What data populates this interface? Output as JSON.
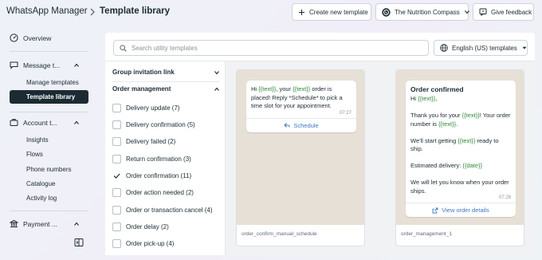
{
  "header": {
    "app_name": "WhatsApp Manager",
    "page_title": "Template library",
    "new_template_label": "Create new template",
    "account_label": "The Nutrition Compass",
    "feedback_label": "Give feedback"
  },
  "sidebar": {
    "overview": "Overview",
    "message_templates": "Message t...",
    "manage_templates": "Manage templates",
    "template_library": "Template library",
    "account_tools": "Account t...",
    "account_items": [
      "Insights",
      "Flows",
      "Phone numbers",
      "Catalogue",
      "Activity log"
    ],
    "payment": "Payment ..."
  },
  "search": {
    "placeholder": "Search utility templates",
    "value": ""
  },
  "language_select": "English (US) templates",
  "categories": {
    "group_invitation": "Group invitation link",
    "order_management": "Order management",
    "items": [
      {
        "label": "Delivery update (7)",
        "checked": false
      },
      {
        "label": "Delivery confirmation (5)",
        "checked": false
      },
      {
        "label": "Delivery failed (2)",
        "checked": false
      },
      {
        "label": "Return confirmation (3)",
        "checked": false
      },
      {
        "label": "Order confirmation (11)",
        "checked": true
      },
      {
        "label": "Order action needed (2)",
        "checked": false
      },
      {
        "label": "Order or transaction cancel (4)",
        "checked": false
      },
      {
        "label": "Order delay (2)",
        "checked": false
      },
      {
        "label": "Order pick-up (4)",
        "checked": false
      }
    ]
  },
  "templates": [
    {
      "name": "order_confirm_manual_schedule",
      "time": "07:27",
      "button": "Schedule"
    },
    {
      "name": "order_management_1",
      "title": "Order confirmed",
      "time": "07:28",
      "button": "View order details"
    }
  ],
  "colors": {
    "accent": "#1c2b33",
    "variable": "#2c8a35",
    "link": "#3a78c3",
    "chat_background": "#e7e0d6"
  }
}
